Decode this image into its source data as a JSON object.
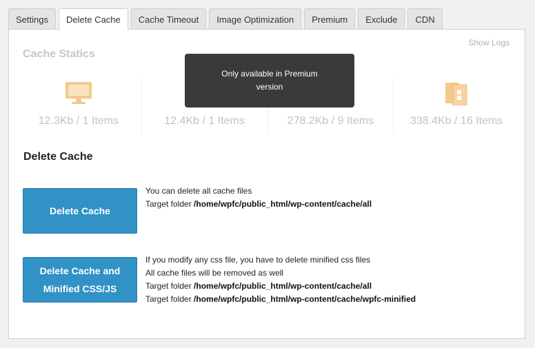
{
  "tabs": [
    {
      "label": "Settings",
      "active": false
    },
    {
      "label": "Delete Cache",
      "active": true
    },
    {
      "label": "Cache Timeout",
      "active": false
    },
    {
      "label": "Image Optimization",
      "active": false
    },
    {
      "label": "Premium",
      "active": false
    },
    {
      "label": "Exclude",
      "active": false
    },
    {
      "label": "CDN",
      "active": false
    }
  ],
  "panel": {
    "show_logs": "Show Logs",
    "cache_statics_title": "Cache Statics",
    "stats": [
      {
        "icon": "monitor-icon",
        "value": "12.3Kb / 1 Items"
      },
      {
        "icon": "mobile-icon",
        "value": "12.4Kb / 1 Items"
      },
      {
        "icon": "css-file-icon",
        "value": "278.2Kb / 9 Items"
      },
      {
        "icon": "js-file-icon",
        "value": "338.4Kb / 16 Items"
      }
    ],
    "tooltip": "Only available in Premium version",
    "delete_cache_title": "Delete Cache",
    "delete_cache_button": "Delete Cache",
    "delete_cache_desc": {
      "line1": "You can delete all cache files",
      "line2_prefix": "Target folder ",
      "line2_path": "/home/wpfc/public_html/wp-content/cache/all"
    },
    "delete_minified_button": "Delete Cache and Minified CSS/JS",
    "delete_minified_desc": {
      "line1": "If you modify any css file, you have to delete minified css files",
      "line2": "All cache files will be removed as well",
      "line3_prefix": "Target folder ",
      "line3_path": "/home/wpfc/public_html/wp-content/cache/all",
      "line4_prefix": "Target folder ",
      "line4_path": "/home/wpfc/public_html/wp-content/cache/wpfc-minified"
    }
  },
  "colors": {
    "accent_button": "#3192c6",
    "icon_orange": "#f5c98a",
    "tooltip_bg": "#3a3a3a"
  }
}
